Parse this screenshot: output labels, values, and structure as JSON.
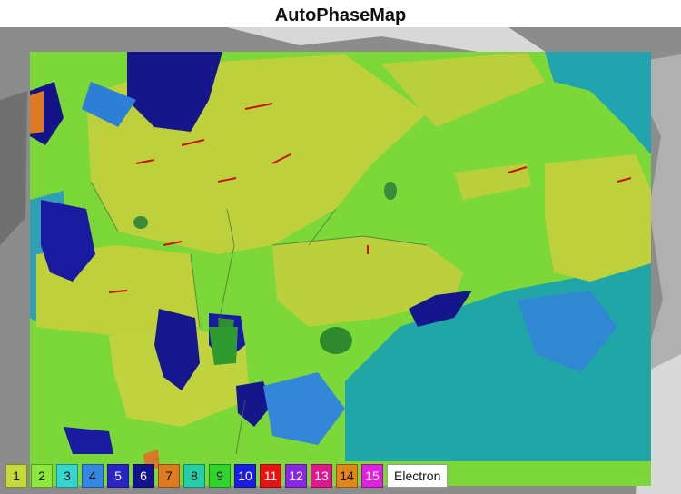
{
  "title": "AutoPhaseMap",
  "legend": {
    "phases": [
      {
        "label": "1",
        "color": "#c4d93a"
      },
      {
        "label": "2",
        "color": "#8ee83c"
      },
      {
        "label": "3",
        "color": "#33d6d0"
      },
      {
        "label": "4",
        "color": "#3388e6"
      },
      {
        "label": "5",
        "color": "#2a23c8"
      },
      {
        "label": "6",
        "color": "#12128e"
      },
      {
        "label": "7",
        "color": "#e07a22"
      },
      {
        "label": "8",
        "color": "#22cfa8"
      },
      {
        "label": "9",
        "color": "#2ed52e"
      },
      {
        "label": "10",
        "color": "#1b1be8"
      },
      {
        "label": "11",
        "color": "#e81212"
      },
      {
        "label": "12",
        "color": "#8a26e6"
      },
      {
        "label": "13",
        "color": "#e0188e"
      },
      {
        "label": "14",
        "color": "#e0861a"
      },
      {
        "label": "15",
        "color": "#e020e0"
      }
    ],
    "electron_label": "Electron"
  },
  "map_colors": {
    "background_gray": "#8a8a8a",
    "olive": "#b8cc3a",
    "green": "#78d838",
    "teal": "#1fa3a3",
    "blue": "#2f7fd0",
    "navy": "#18188a",
    "dark_green": "#2f8f2f",
    "red": "#cc1111"
  }
}
